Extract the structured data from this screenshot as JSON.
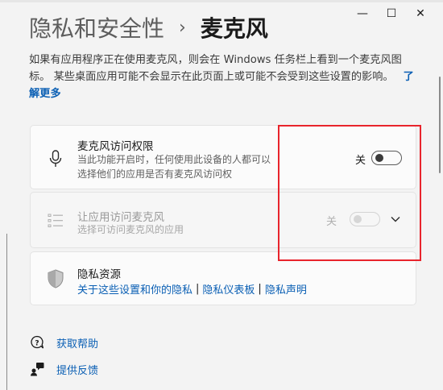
{
  "window_controls": {
    "minimize": "—",
    "maximize": "☐",
    "close": "✕"
  },
  "breadcrumb": {
    "parent": "隐私和安全性",
    "separator": "›",
    "current": "麦克风"
  },
  "description": {
    "text": "如果有应用程序正在使用麦克风，则会在 Windows 任务栏上看到一个麦克风图标。 某些桌面应用可能不会显示在此页面上或可能不会受到这些设置的影响。",
    "learn_more": "了解更多"
  },
  "mic_access": {
    "icon": "microphone-icon",
    "title": "麦克风访问权限",
    "subtitle": "当此功能开启时，任何使用此设备的人都可以选择他们的应用是否有麦克风访问权",
    "toggle_label": "关",
    "toggle_on": false
  },
  "app_access": {
    "icon": "list-icon",
    "title": "让应用访问麦克风",
    "subtitle": "选择可访问麦克风的应用",
    "toggle_label": "关",
    "toggle_on": false,
    "disabled": true
  },
  "privacy_resources": {
    "icon": "shield-icon",
    "title": "隐私资源",
    "links": [
      "关于这些设置和你的隐私",
      "隐私仪表板",
      "隐私声明"
    ],
    "separator": "|"
  },
  "footer": {
    "help": "获取帮助",
    "feedback": "提供反馈"
  },
  "colors": {
    "accent_link": "#0a5fb4",
    "highlight_box": "#e8242c"
  }
}
